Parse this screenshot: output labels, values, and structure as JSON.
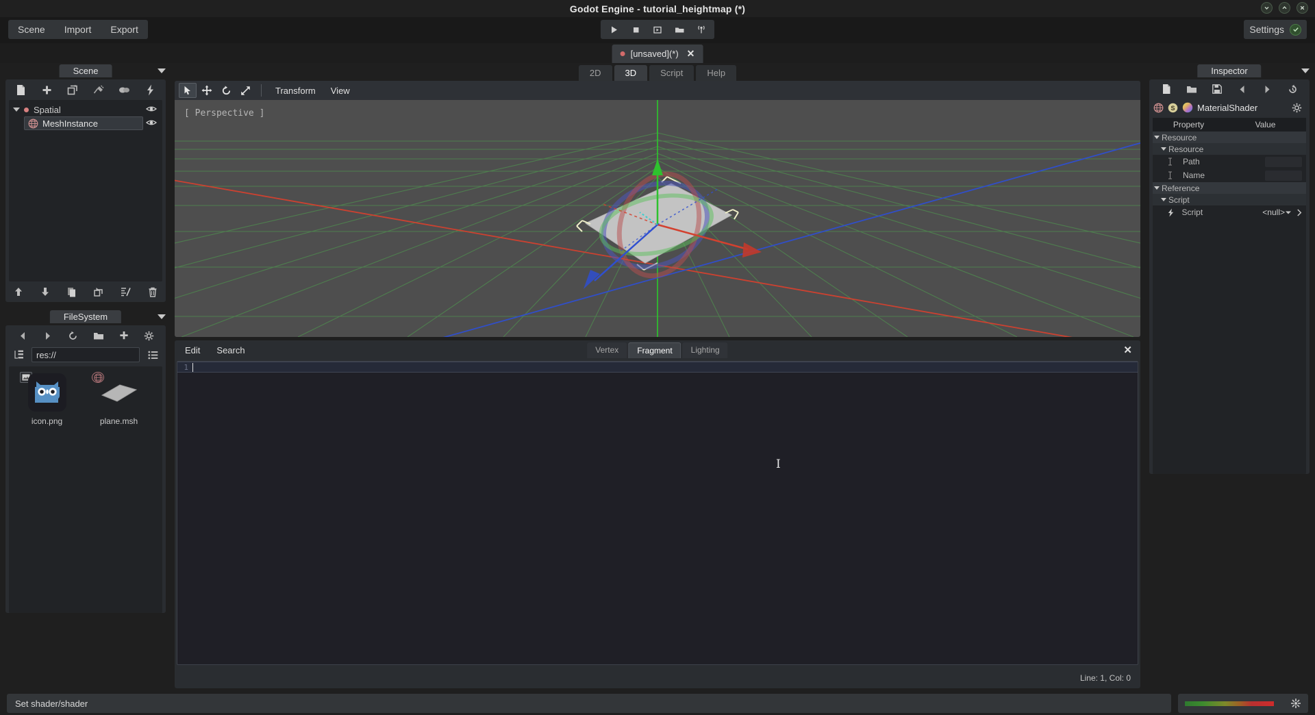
{
  "window": {
    "title": "Godot Engine - tutorial_heightmap (*)",
    "minimize_icon": "chevron-down-icon",
    "maximize_icon": "chevron-up-icon",
    "close_icon": "close-icon"
  },
  "menubar": {
    "items": [
      {
        "label": "Scene",
        "name": "menu-scene"
      },
      {
        "label": "Import",
        "name": "menu-import"
      },
      {
        "label": "Export",
        "name": "menu-export"
      }
    ],
    "playback": [
      {
        "name": "play-button",
        "icon": "play-icon",
        "tooltip": "Play"
      },
      {
        "name": "stop-button",
        "icon": "stop-icon",
        "tooltip": "Stop"
      },
      {
        "name": "play-scene-button",
        "icon": "play-scene-icon",
        "tooltip": "Play Scene"
      },
      {
        "name": "play-custom-scene-button",
        "icon": "folder-play-icon",
        "tooltip": "Play Custom Scene"
      },
      {
        "name": "remote-debug-button",
        "icon": "antenna-icon",
        "tooltip": "Remote Debug"
      }
    ],
    "settings_label": "Settings",
    "settings_check_icon": "check-icon"
  },
  "scene_tabs": {
    "tabs": [
      {
        "label": "[unsaved](*)",
        "unsaved_dot": true,
        "active": true,
        "close_icon": "close-icon"
      }
    ]
  },
  "scene_dock": {
    "title": "Scene",
    "menu_arrow_icon": "chevron-down-icon",
    "toolbar": [
      {
        "name": "new-scene-button",
        "icon": "file-icon"
      },
      {
        "name": "add-node-button",
        "icon": "plus-icon"
      },
      {
        "name": "instance-scene-button",
        "icon": "instance-icon"
      },
      {
        "name": "connect-signal-button",
        "icon": "plug-icon"
      },
      {
        "name": "group-button",
        "icon": "group-icon"
      },
      {
        "name": "script-button",
        "icon": "lightning-icon"
      }
    ],
    "tree": [
      {
        "label": "Spatial",
        "depth": 0,
        "expanded": true,
        "icon": "spatial-dot-icon",
        "selected": false,
        "visibility_icon": "eye-icon"
      },
      {
        "label": "MeshInstance",
        "depth": 1,
        "expanded": false,
        "icon": "meshinstance-icon",
        "selected": true,
        "visibility_icon": "eye-icon"
      }
    ],
    "bottom_toolbar": [
      {
        "name": "move-up-button",
        "icon": "arrow-up-icon"
      },
      {
        "name": "move-down-button",
        "icon": "arrow-down-icon"
      },
      {
        "name": "duplicate-button",
        "icon": "duplicate-icon"
      },
      {
        "name": "reparent-button",
        "icon": "reparent-icon"
      },
      {
        "name": "edit-script-button",
        "icon": "script-edit-icon"
      },
      {
        "name": "delete-button",
        "icon": "trash-icon"
      }
    ]
  },
  "filesystem_dock": {
    "title": "FileSystem",
    "menu_arrow_icon": "chevron-down-icon",
    "nav": [
      {
        "name": "back-button",
        "icon": "arrow-left-icon"
      },
      {
        "name": "forward-button",
        "icon": "arrow-right-icon"
      },
      {
        "name": "refresh-button",
        "icon": "refresh-icon"
      },
      {
        "name": "new-folder-button",
        "icon": "folder-icon"
      },
      {
        "name": "add-button",
        "icon": "plus-icon"
      },
      {
        "name": "options-button",
        "icon": "gear-icon"
      }
    ],
    "tree_toggle_icon": "tree-view-icon",
    "list_toggle_icon": "list-view-icon",
    "path_value": "res://",
    "path_placeholder": "res://",
    "files": [
      {
        "name": "icon.png",
        "thumb": "godot-robot-icon",
        "badge": "image-badge-icon"
      },
      {
        "name": "plane.msh",
        "thumb": "plane-mesh-icon",
        "badge": "mesh-badge-icon"
      }
    ]
  },
  "editor_tabs": [
    {
      "label": "2D",
      "active": false,
      "name": "tab-2d"
    },
    {
      "label": "3D",
      "active": true,
      "name": "tab-3d"
    },
    {
      "label": "Script",
      "active": false,
      "name": "tab-script"
    },
    {
      "label": "Help",
      "active": false,
      "name": "tab-help"
    }
  ],
  "viewport": {
    "tools": [
      {
        "name": "select-mode-button",
        "icon": "cursor-icon",
        "active": true
      },
      {
        "name": "move-mode-button",
        "icon": "move-icon",
        "active": false
      },
      {
        "name": "rotate-mode-button",
        "icon": "rotate-icon",
        "active": false
      },
      {
        "name": "scale-mode-button",
        "icon": "scale-icon",
        "active": false
      }
    ],
    "menus": [
      {
        "label": "Transform",
        "name": "viewport-menu-transform"
      },
      {
        "label": "View",
        "name": "viewport-menu-view"
      }
    ],
    "perspective_label": "[ Perspective ]",
    "grid_color": "#3f7a3f",
    "axis_x_color": "#cc3b2f",
    "axis_y_color": "#2fbf2f",
    "axis_z_color": "#3050cc",
    "background_color": "#4e4e4e"
  },
  "shader_editor": {
    "menus": [
      {
        "label": "Edit",
        "name": "shader-menu-edit"
      },
      {
        "label": "Search",
        "name": "shader-menu-search"
      }
    ],
    "tabs": [
      {
        "label": "Vertex",
        "active": false,
        "name": "shader-tab-vertex"
      },
      {
        "label": "Fragment",
        "active": true,
        "name": "shader-tab-fragment"
      },
      {
        "label": "Lighting",
        "active": false,
        "name": "shader-tab-lighting"
      }
    ],
    "close_icon": "close-icon",
    "code_lines": [
      {
        "number": "1",
        "text": ""
      }
    ],
    "status": "Line: 1, Col: 0"
  },
  "inspector": {
    "title": "Inspector",
    "menu_arrow_icon": "chevron-down-icon",
    "toolbar": [
      {
        "name": "new-resource-button",
        "icon": "file-icon"
      },
      {
        "name": "open-resource-button",
        "icon": "folder-icon"
      },
      {
        "name": "save-resource-button",
        "icon": "save-icon"
      },
      {
        "name": "history-back-button",
        "icon": "arrow-left-icon"
      },
      {
        "name": "history-forward-button",
        "icon": "arrow-right-icon"
      },
      {
        "name": "revert-button",
        "icon": "history-icon"
      }
    ],
    "resource_icons": [
      "meshinstance-icon",
      "shader-s-icon",
      "material-sphere-icon"
    ],
    "resource_name": "MaterialShader",
    "options_icon": "gear-icon",
    "columns": {
      "property": "Property",
      "value": "Value"
    },
    "rows": [
      {
        "label": "Resource",
        "type": "category",
        "depth": 0,
        "expanded": true
      },
      {
        "label": "Resource",
        "type": "section",
        "depth": 1,
        "expanded": true
      },
      {
        "label": "Path",
        "type": "property",
        "depth": 2,
        "value": "",
        "icon": "text-field-icon"
      },
      {
        "label": "Name",
        "type": "property",
        "depth": 2,
        "value": "",
        "icon": "text-field-icon"
      },
      {
        "label": "Reference",
        "type": "category",
        "depth": 0,
        "expanded": true
      },
      {
        "label": "Script",
        "type": "section",
        "depth": 1,
        "expanded": true
      },
      {
        "label": "Script",
        "type": "property",
        "depth": 2,
        "value": "<null>",
        "icon": "lightning-icon",
        "dropdown_icon": "chevron-down-icon",
        "expand_icon": "chevron-right-icon"
      }
    ]
  },
  "statusbar": {
    "message": "Set shader/shader",
    "memory_bar_name": "memory-usage-bar",
    "light_icon": "light-bulb-icon"
  }
}
